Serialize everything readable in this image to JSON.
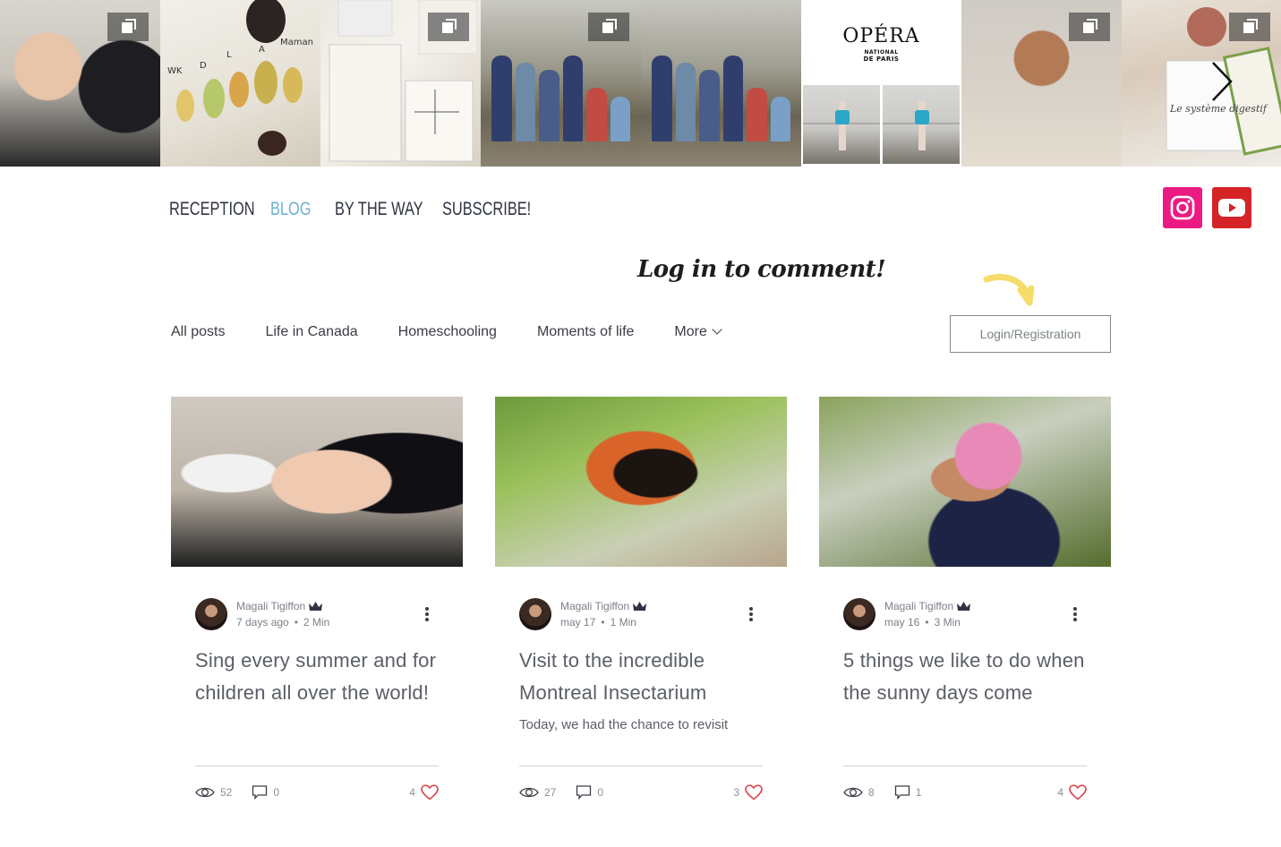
{
  "gallery": {
    "tiles": [
      {
        "name": "gallery-tile-recording",
        "multi": false
      },
      {
        "name": "gallery-tile-insects",
        "multi": true
      },
      {
        "name": "gallery-tile-notebooks",
        "multi": true
      },
      {
        "name": "gallery-tile-climbing-group-1",
        "multi": true
      },
      {
        "name": "gallery-tile-climbing-group-2",
        "multi": false
      },
      {
        "name": "gallery-tile-opera",
        "multi": false,
        "logo_main": "OPÉRA",
        "logo_sub1": "NATIONAL",
        "logo_sub2": "DE PARIS"
      },
      {
        "name": "gallery-tile-child-surprised",
        "multi": true
      },
      {
        "name": "gallery-tile-digestive-system",
        "multi": true
      }
    ],
    "insect_labels": [
      "WK",
      "D",
      "L",
      "A",
      "Maman"
    ],
    "notebook_caption": "Le système digestif"
  },
  "nav": {
    "items": [
      {
        "label": "RECEPTION",
        "active": false
      },
      {
        "label": "BLOG",
        "active": true
      },
      {
        "label": "BY THE WAY",
        "active": false
      },
      {
        "label": "SUBSCRIBE!",
        "active": false
      }
    ],
    "active_color": "#6fb1d1"
  },
  "social": {
    "instagram": {
      "icon": "instagram-icon",
      "color": "#ec1b84"
    },
    "youtube": {
      "icon": "youtube-icon",
      "color": "#d42428"
    }
  },
  "login": {
    "note": "Log in to comment!",
    "button_label": "Login/Registration",
    "arrow_color": "#f6dc6a"
  },
  "categories": {
    "items": [
      "All posts",
      "Life in Canada",
      "Homeschooling",
      "Moments of life"
    ],
    "more_label": "More"
  },
  "posts": [
    {
      "author": "Magali Tigiffon",
      "date": "7 days ago",
      "read_time": "2 Min",
      "title": "Sing every summer and for children all over the world!",
      "excerpt": "",
      "views": "52",
      "comments": "0",
      "likes": "4"
    },
    {
      "author": "Magali Tigiffon",
      "date": "may 17",
      "read_time": "1 Min",
      "title": "Visit to the incredible Montreal Insectarium",
      "excerpt": "Today, we had the chance to revisit",
      "views": "27",
      "comments": "0",
      "likes": "3"
    },
    {
      "author": "Magali Tigiffon",
      "date": "may 16",
      "read_time": "3 Min",
      "title": "5 things we like to do when the sunny days come",
      "excerpt": "",
      "views": "8",
      "comments": "1",
      "likes": "4"
    }
  ],
  "colors": {
    "heart": "#d9474d",
    "text_gray": "#7a7f88"
  }
}
